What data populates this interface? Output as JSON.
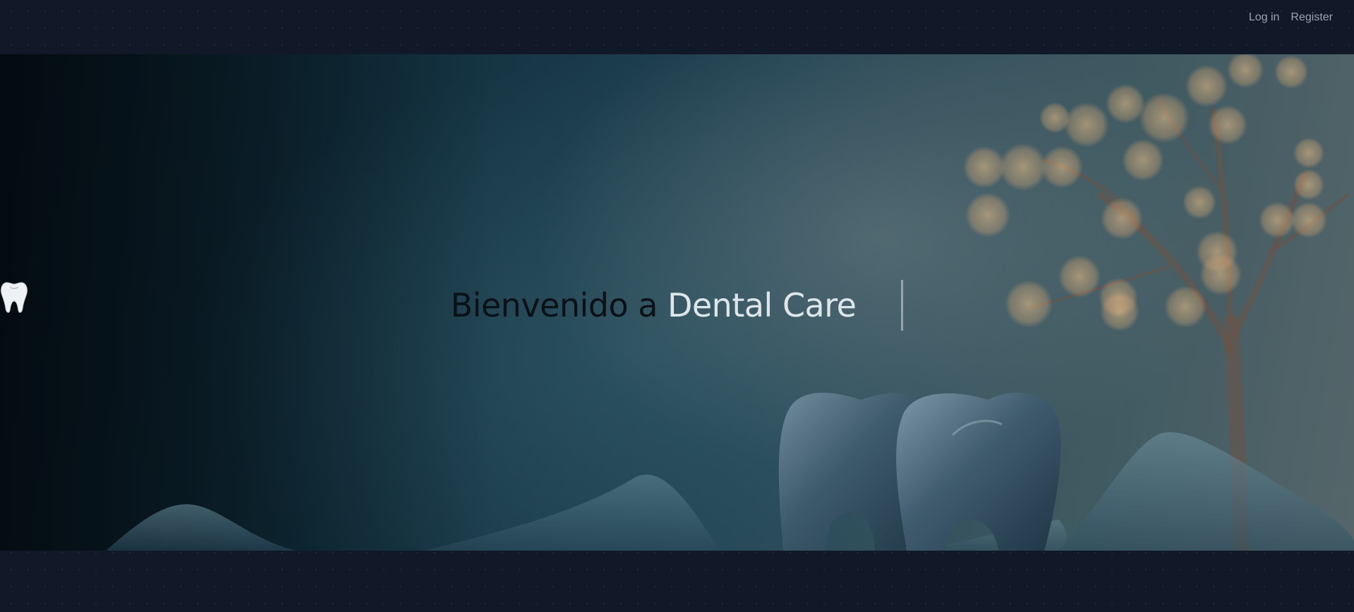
{
  "nav": {
    "login_label": "Log in",
    "register_label": "Register"
  },
  "hero": {
    "title_prefix": "Bienvenido a",
    "title_highlight": "Dental Care",
    "title_icon": "tooth-icon"
  },
  "colors": {
    "page_background": "#111827",
    "nav_text": "#9ca3af",
    "title_dark": "#0b1116",
    "title_light": "#dfe6ea"
  }
}
